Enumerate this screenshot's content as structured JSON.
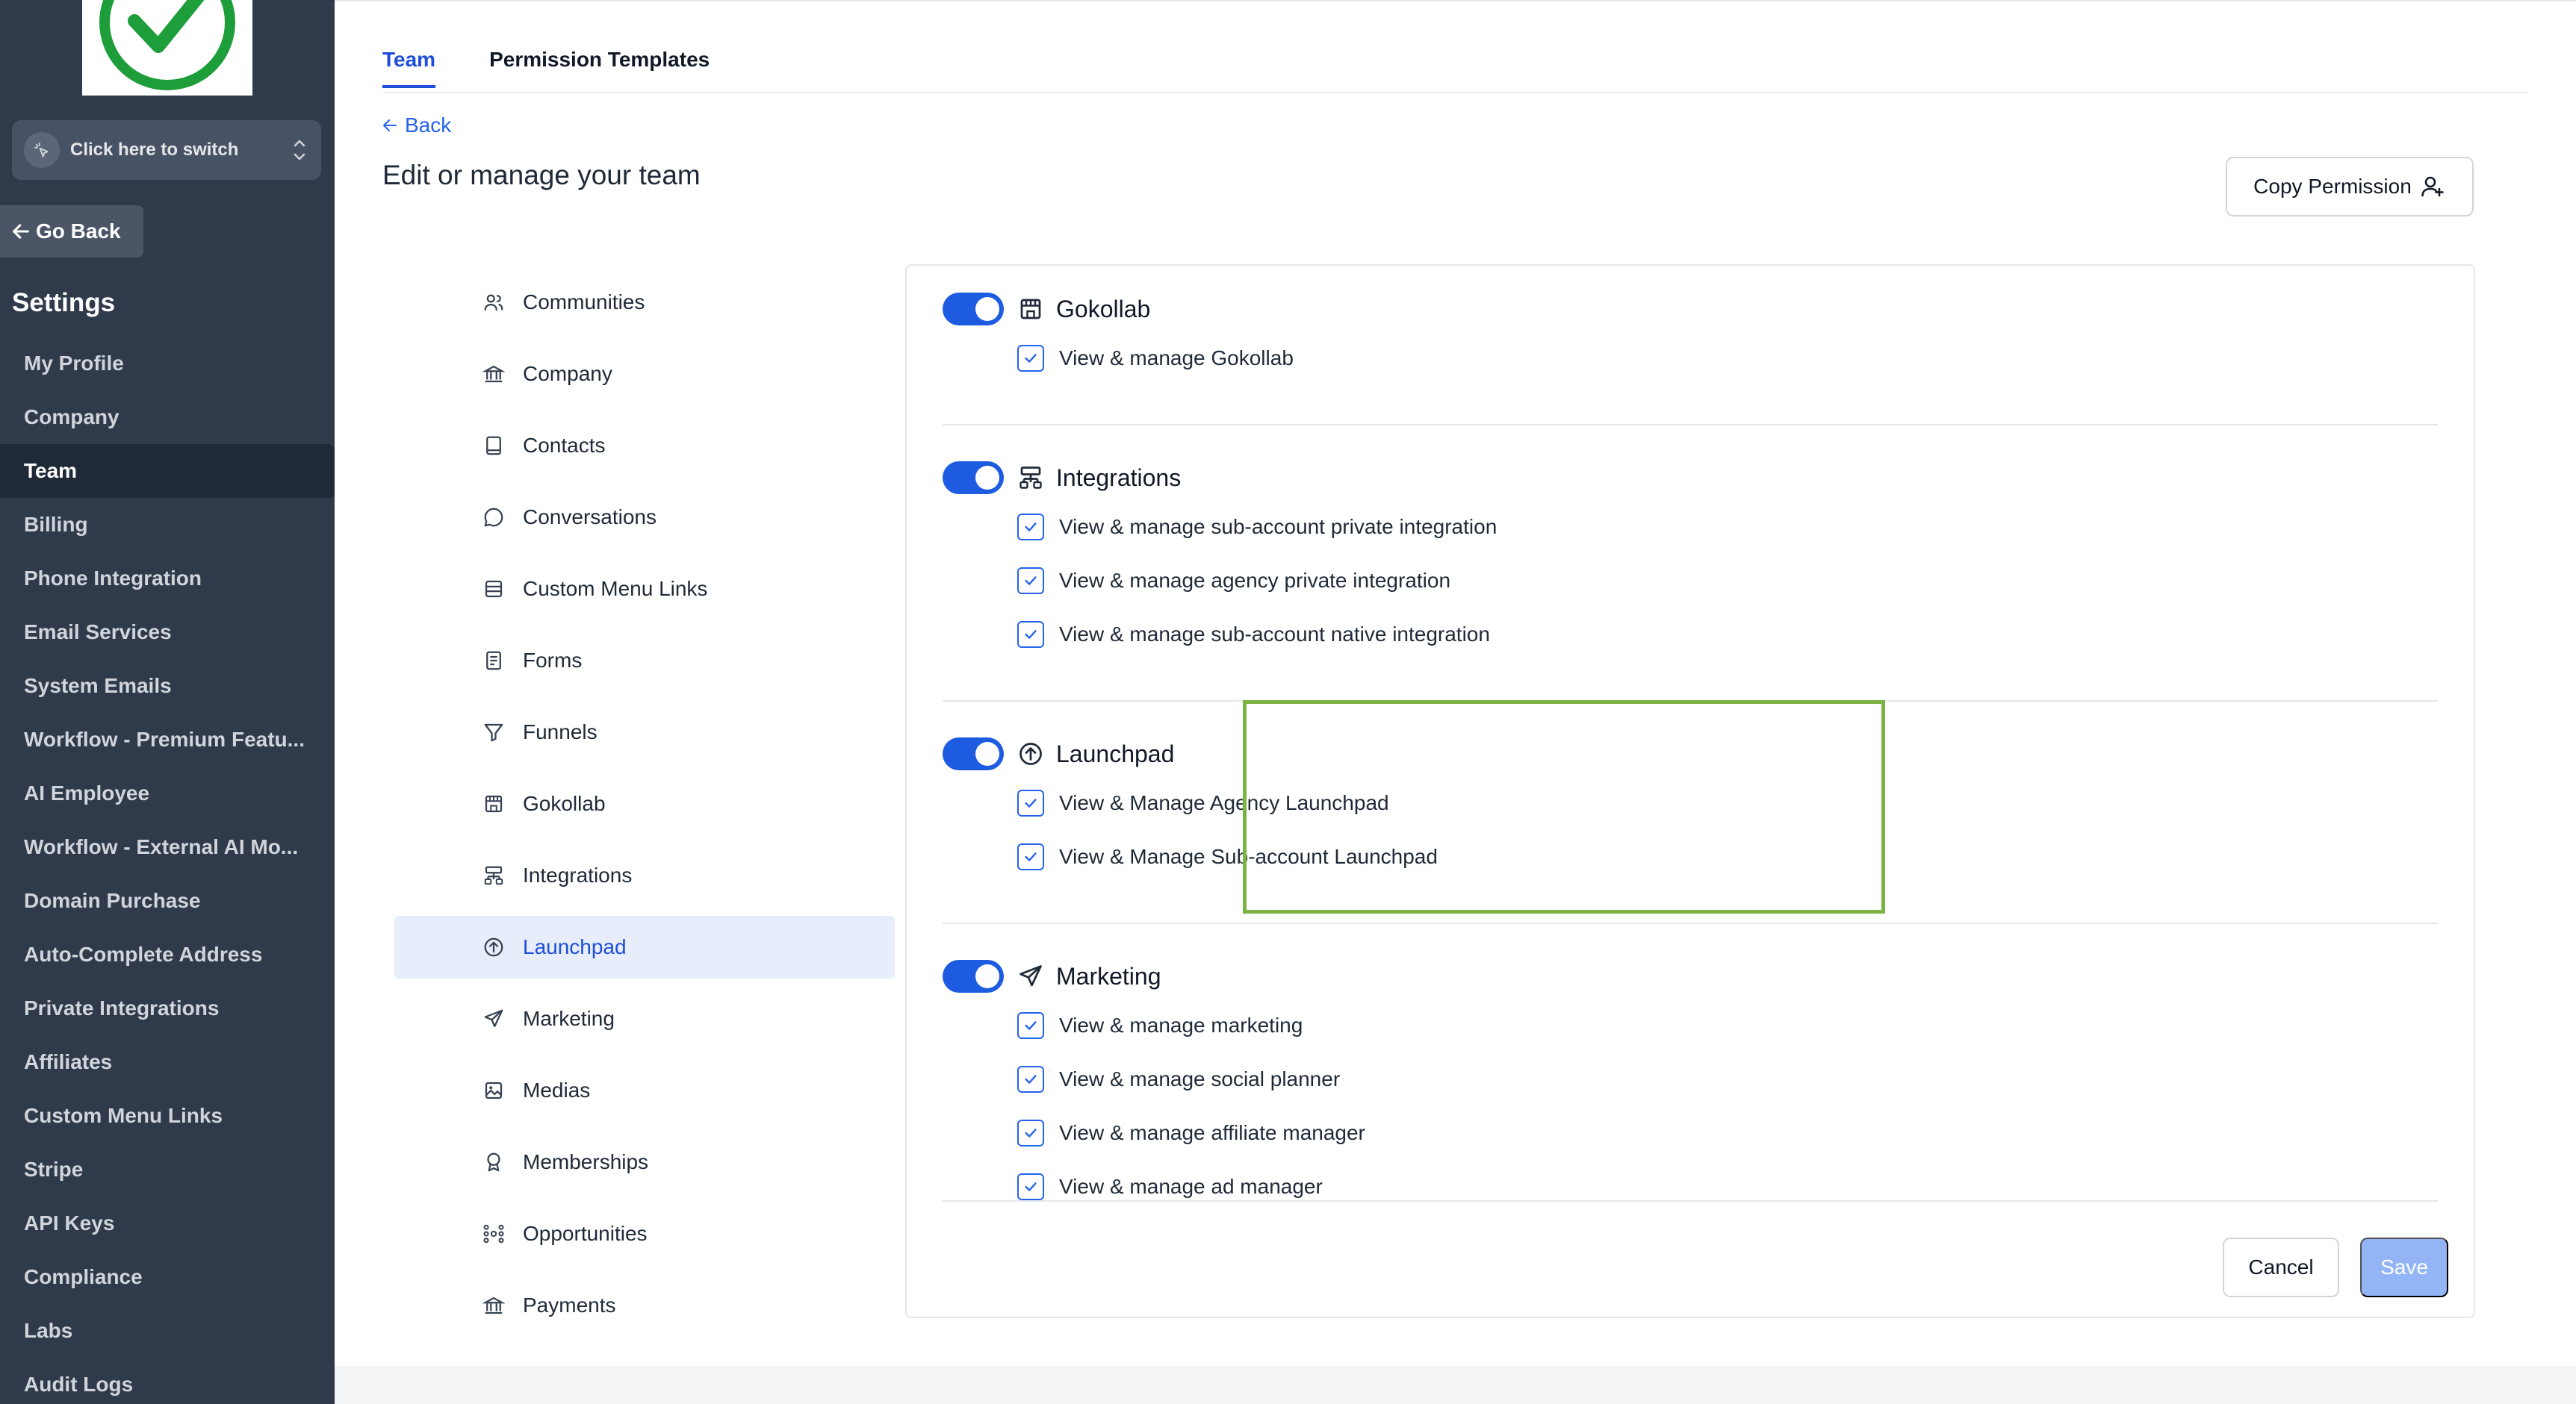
{
  "sidebar": {
    "switcher_label": "Click here to switch",
    "go_back": "Go Back",
    "settings_title": "Settings",
    "items": [
      {
        "label": "My Profile"
      },
      {
        "label": "Company"
      },
      {
        "label": "Team",
        "active": true
      },
      {
        "label": "Billing"
      },
      {
        "label": "Phone Integration"
      },
      {
        "label": "Email Services"
      },
      {
        "label": "System Emails"
      },
      {
        "label": "Workflow - Premium Featu..."
      },
      {
        "label": "AI Employee"
      },
      {
        "label": "Workflow - External AI Mo..."
      },
      {
        "label": "Domain Purchase"
      },
      {
        "label": "Auto-Complete Address"
      },
      {
        "label": "Private Integrations"
      },
      {
        "label": "Affiliates"
      },
      {
        "label": "Custom Menu Links"
      },
      {
        "label": "Stripe"
      },
      {
        "label": "API Keys"
      },
      {
        "label": "Compliance"
      },
      {
        "label": "Labs"
      },
      {
        "label": "Audit Logs"
      }
    ]
  },
  "header": {
    "tabs": [
      {
        "label": "Team",
        "active": true
      },
      {
        "label": "Permission Templates"
      }
    ],
    "back_label": "Back",
    "page_title": "Edit or manage your team",
    "copy_permission_label": "Copy Permission"
  },
  "categories": [
    {
      "label": "Communities",
      "icon": "users-icon"
    },
    {
      "label": "Company",
      "icon": "bank-icon"
    },
    {
      "label": "Contacts",
      "icon": "contact-book-icon"
    },
    {
      "label": "Conversations",
      "icon": "chat-bubble-icon"
    },
    {
      "label": "Custom Menu Links",
      "icon": "menu-list-icon"
    },
    {
      "label": "Forms",
      "icon": "form-icon"
    },
    {
      "label": "Funnels",
      "icon": "funnel-icon"
    },
    {
      "label": "Gokollab",
      "icon": "store-icon"
    },
    {
      "label": "Integrations",
      "icon": "integrations-icon"
    },
    {
      "label": "Launchpad",
      "icon": "arrow-up-circle-icon",
      "active": true
    },
    {
      "label": "Marketing",
      "icon": "send-icon"
    },
    {
      "label": "Medias",
      "icon": "image-icon"
    },
    {
      "label": "Memberships",
      "icon": "award-icon"
    },
    {
      "label": "Opportunities",
      "icon": "network-icon"
    },
    {
      "label": "Payments",
      "icon": "bank-icon"
    }
  ],
  "permissions": [
    {
      "title": "Gokollab",
      "icon": "store-icon",
      "enabled": true,
      "items": [
        "View & manage Gokollab"
      ]
    },
    {
      "title": "Integrations",
      "icon": "integrations-icon",
      "enabled": true,
      "items": [
        "View & manage sub-account private integration",
        "View & manage agency private integration",
        "View & manage sub-account native integration"
      ]
    },
    {
      "title": "Launchpad",
      "icon": "arrow-up-circle-icon",
      "enabled": true,
      "items": [
        "View & Manage Agency Launchpad",
        "View & Manage Sub-account Launchpad"
      ]
    },
    {
      "title": "Marketing",
      "icon": "send-icon",
      "enabled": true,
      "items": [
        "View & manage marketing",
        "View & manage social planner",
        "View & manage affiliate manager",
        "View & manage ad manager"
      ]
    }
  ],
  "footer": {
    "cancel_label": "Cancel",
    "save_label": "Save"
  },
  "colors": {
    "sidebar_bg": "#2f3a4b",
    "accent": "#1d5ce0",
    "highlight_border": "#7cb342",
    "logo_check": "#1e9e3a"
  }
}
